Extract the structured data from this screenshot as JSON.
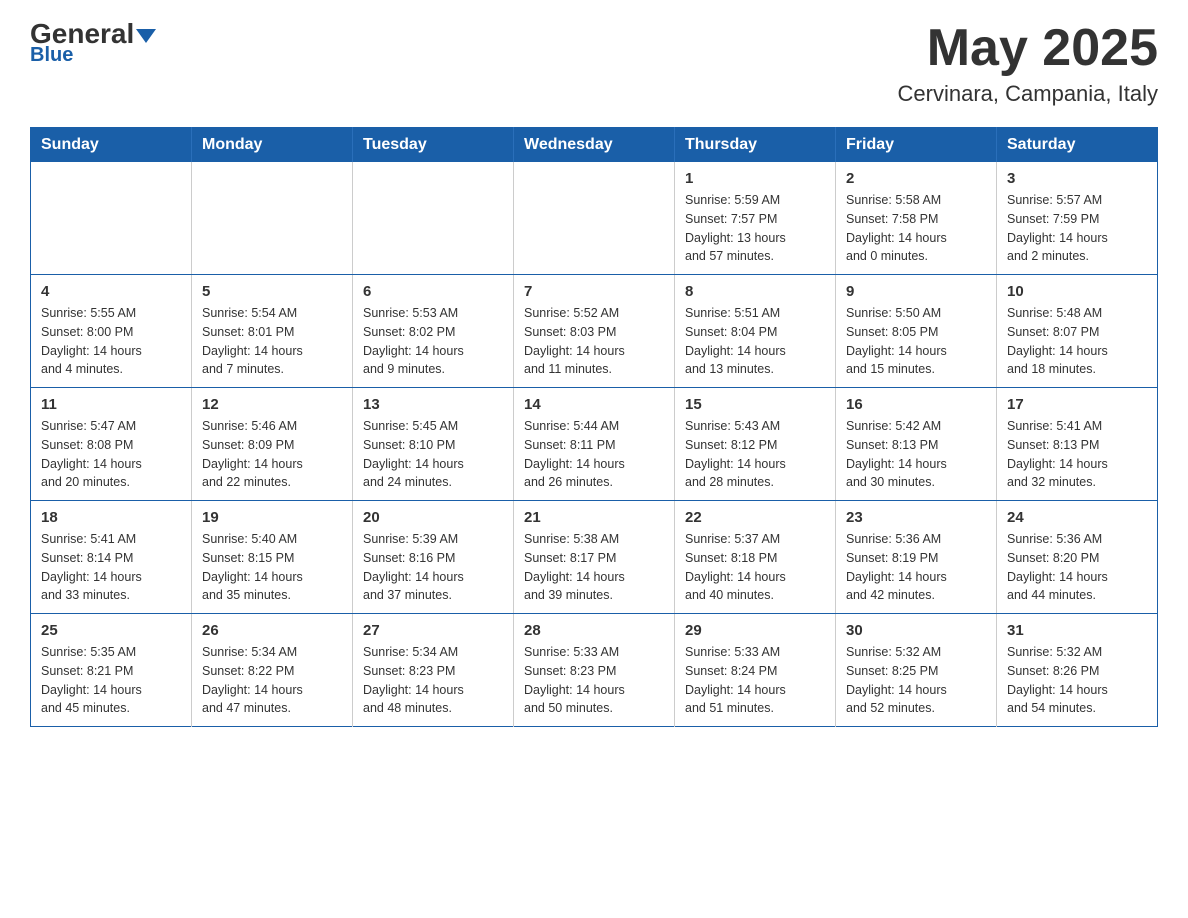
{
  "header": {
    "logo_general": "General",
    "logo_blue": "Blue",
    "month_title": "May 2025",
    "location": "Cervinara, Campania, Italy"
  },
  "weekdays": [
    "Sunday",
    "Monday",
    "Tuesday",
    "Wednesday",
    "Thursday",
    "Friday",
    "Saturday"
  ],
  "weeks": [
    [
      {
        "day": "",
        "info": ""
      },
      {
        "day": "",
        "info": ""
      },
      {
        "day": "",
        "info": ""
      },
      {
        "day": "",
        "info": ""
      },
      {
        "day": "1",
        "info": "Sunrise: 5:59 AM\nSunset: 7:57 PM\nDaylight: 13 hours\nand 57 minutes."
      },
      {
        "day": "2",
        "info": "Sunrise: 5:58 AM\nSunset: 7:58 PM\nDaylight: 14 hours\nand 0 minutes."
      },
      {
        "day": "3",
        "info": "Sunrise: 5:57 AM\nSunset: 7:59 PM\nDaylight: 14 hours\nand 2 minutes."
      }
    ],
    [
      {
        "day": "4",
        "info": "Sunrise: 5:55 AM\nSunset: 8:00 PM\nDaylight: 14 hours\nand 4 minutes."
      },
      {
        "day": "5",
        "info": "Sunrise: 5:54 AM\nSunset: 8:01 PM\nDaylight: 14 hours\nand 7 minutes."
      },
      {
        "day": "6",
        "info": "Sunrise: 5:53 AM\nSunset: 8:02 PM\nDaylight: 14 hours\nand 9 minutes."
      },
      {
        "day": "7",
        "info": "Sunrise: 5:52 AM\nSunset: 8:03 PM\nDaylight: 14 hours\nand 11 minutes."
      },
      {
        "day": "8",
        "info": "Sunrise: 5:51 AM\nSunset: 8:04 PM\nDaylight: 14 hours\nand 13 minutes."
      },
      {
        "day": "9",
        "info": "Sunrise: 5:50 AM\nSunset: 8:05 PM\nDaylight: 14 hours\nand 15 minutes."
      },
      {
        "day": "10",
        "info": "Sunrise: 5:48 AM\nSunset: 8:07 PM\nDaylight: 14 hours\nand 18 minutes."
      }
    ],
    [
      {
        "day": "11",
        "info": "Sunrise: 5:47 AM\nSunset: 8:08 PM\nDaylight: 14 hours\nand 20 minutes."
      },
      {
        "day": "12",
        "info": "Sunrise: 5:46 AM\nSunset: 8:09 PM\nDaylight: 14 hours\nand 22 minutes."
      },
      {
        "day": "13",
        "info": "Sunrise: 5:45 AM\nSunset: 8:10 PM\nDaylight: 14 hours\nand 24 minutes."
      },
      {
        "day": "14",
        "info": "Sunrise: 5:44 AM\nSunset: 8:11 PM\nDaylight: 14 hours\nand 26 minutes."
      },
      {
        "day": "15",
        "info": "Sunrise: 5:43 AM\nSunset: 8:12 PM\nDaylight: 14 hours\nand 28 minutes."
      },
      {
        "day": "16",
        "info": "Sunrise: 5:42 AM\nSunset: 8:13 PM\nDaylight: 14 hours\nand 30 minutes."
      },
      {
        "day": "17",
        "info": "Sunrise: 5:41 AM\nSunset: 8:13 PM\nDaylight: 14 hours\nand 32 minutes."
      }
    ],
    [
      {
        "day": "18",
        "info": "Sunrise: 5:41 AM\nSunset: 8:14 PM\nDaylight: 14 hours\nand 33 minutes."
      },
      {
        "day": "19",
        "info": "Sunrise: 5:40 AM\nSunset: 8:15 PM\nDaylight: 14 hours\nand 35 minutes."
      },
      {
        "day": "20",
        "info": "Sunrise: 5:39 AM\nSunset: 8:16 PM\nDaylight: 14 hours\nand 37 minutes."
      },
      {
        "day": "21",
        "info": "Sunrise: 5:38 AM\nSunset: 8:17 PM\nDaylight: 14 hours\nand 39 minutes."
      },
      {
        "day": "22",
        "info": "Sunrise: 5:37 AM\nSunset: 8:18 PM\nDaylight: 14 hours\nand 40 minutes."
      },
      {
        "day": "23",
        "info": "Sunrise: 5:36 AM\nSunset: 8:19 PM\nDaylight: 14 hours\nand 42 minutes."
      },
      {
        "day": "24",
        "info": "Sunrise: 5:36 AM\nSunset: 8:20 PM\nDaylight: 14 hours\nand 44 minutes."
      }
    ],
    [
      {
        "day": "25",
        "info": "Sunrise: 5:35 AM\nSunset: 8:21 PM\nDaylight: 14 hours\nand 45 minutes."
      },
      {
        "day": "26",
        "info": "Sunrise: 5:34 AM\nSunset: 8:22 PM\nDaylight: 14 hours\nand 47 minutes."
      },
      {
        "day": "27",
        "info": "Sunrise: 5:34 AM\nSunset: 8:23 PM\nDaylight: 14 hours\nand 48 minutes."
      },
      {
        "day": "28",
        "info": "Sunrise: 5:33 AM\nSunset: 8:23 PM\nDaylight: 14 hours\nand 50 minutes."
      },
      {
        "day": "29",
        "info": "Sunrise: 5:33 AM\nSunset: 8:24 PM\nDaylight: 14 hours\nand 51 minutes."
      },
      {
        "day": "30",
        "info": "Sunrise: 5:32 AM\nSunset: 8:25 PM\nDaylight: 14 hours\nand 52 minutes."
      },
      {
        "day": "31",
        "info": "Sunrise: 5:32 AM\nSunset: 8:26 PM\nDaylight: 14 hours\nand 54 minutes."
      }
    ]
  ]
}
